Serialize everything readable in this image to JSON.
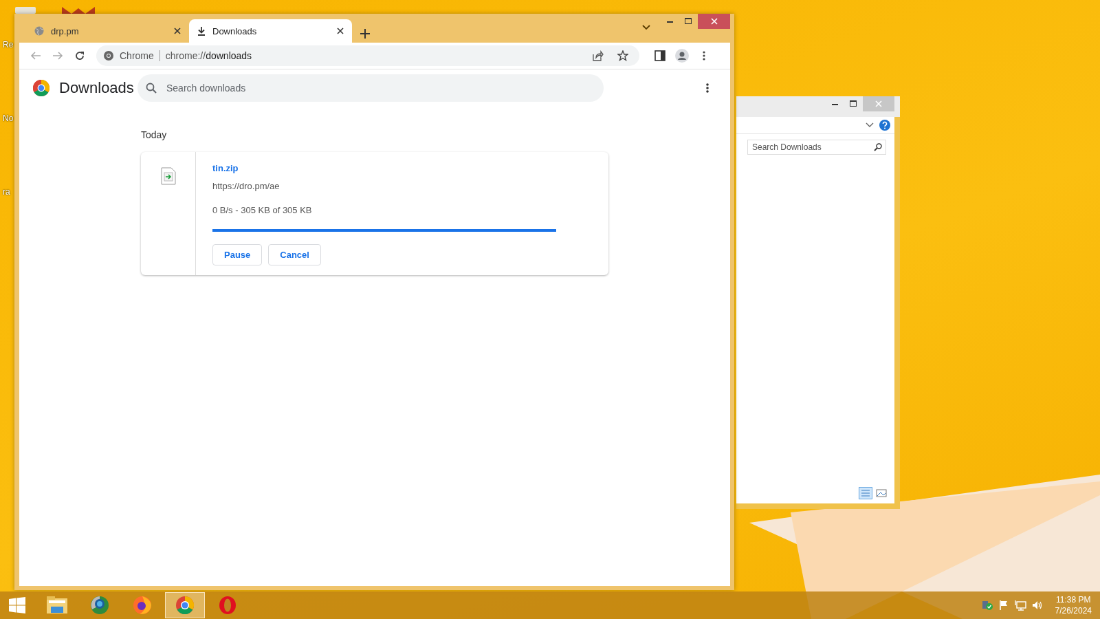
{
  "desktop": {
    "icon_labels": [
      "Re",
      "No",
      "ra"
    ]
  },
  "browser": {
    "tabs": [
      {
        "title": "drp.pm",
        "kind": "site",
        "selected": false
      },
      {
        "title": "Downloads",
        "kind": "download",
        "selected": true
      }
    ],
    "address": {
      "chip": "Chrome",
      "url_prefix": "chrome://",
      "url_path": "downloads"
    },
    "page": {
      "title": "Downloads",
      "search": {
        "placeholder": "Search downloads"
      },
      "sections": [
        {
          "heading": "Today",
          "items": [
            {
              "file_name": "tin.zip",
              "source": "https://dro.pm/ae",
              "status": "0 B/s - 305 KB of 305 KB",
              "level": 1,
              "buttons": [
                "Pause",
                "Cancel"
              ]
            }
          ]
        }
      ]
    }
  },
  "explorer": {
    "search": {
      "placeholder": "Search Downloads"
    }
  },
  "taskbar": {
    "apps": [
      {
        "kind": "folder",
        "selected": false
      },
      {
        "kind": "globe",
        "selected": false
      },
      {
        "kind": "firefox",
        "selected": false
      },
      {
        "kind": "chrome",
        "selected": true
      },
      {
        "kind": "opera",
        "selected": false
      }
    ],
    "clock": {
      "time": "11:38 PM",
      "date": "7/26/2024"
    }
  }
}
